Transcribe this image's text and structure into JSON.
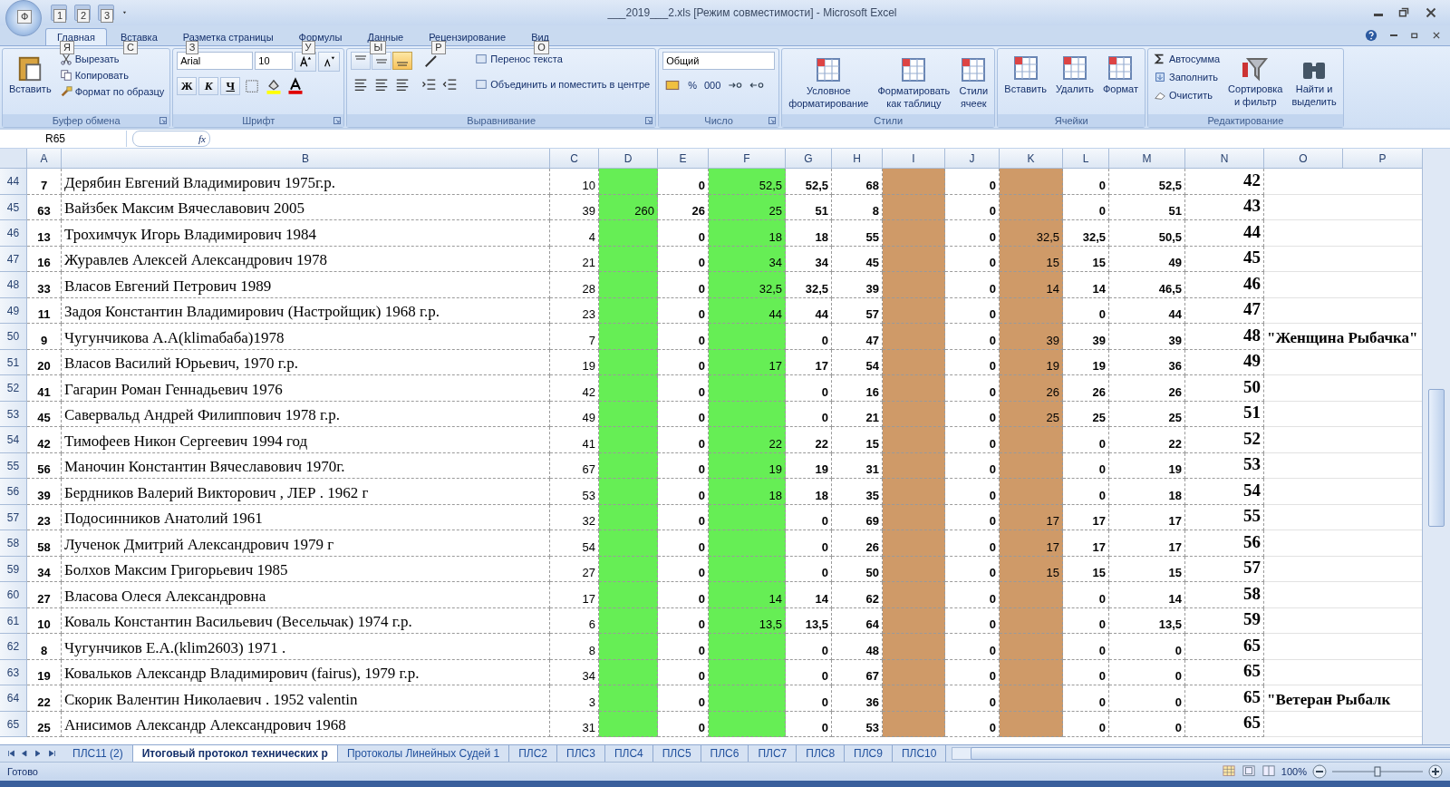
{
  "window": {
    "title": "___2019___2.xls  [Режим совместимости] - Microsoft Excel",
    "office_keytip": "Ф",
    "quick_access_keytips": [
      "1",
      "2",
      "3"
    ]
  },
  "ribbon_tabs": [
    {
      "label": "Главная",
      "keytip": "Я",
      "selected": true
    },
    {
      "label": "Вставка",
      "keytip": "С",
      "selected": false
    },
    {
      "label": "Разметка страницы",
      "keytip": "З",
      "selected": false
    },
    {
      "label": "Формулы",
      "keytip": "У",
      "selected": false
    },
    {
      "label": "Данные",
      "keytip": "Ы",
      "selected": false
    },
    {
      "label": "Рецензирование",
      "keytip": "Р",
      "selected": false
    },
    {
      "label": "Вид",
      "keytip": "О",
      "selected": false
    }
  ],
  "ribbon": {
    "clipboard": {
      "label": "Буфер обмена",
      "paste": "Вставить",
      "items": [
        "Вырезать",
        "Копировать",
        "Формат по образцу"
      ]
    },
    "font": {
      "label": "Шрифт",
      "font_name": "Arial",
      "font_size": "10",
      "styles": [
        "Ж",
        "К",
        "Ч"
      ]
    },
    "alignment": {
      "label": "Выравнивание",
      "vertical": [
        {
          "selected": false
        },
        {
          "selected": false
        },
        {
          "selected": true
        }
      ],
      "wrap": "Перенос текста",
      "merge": "Объединить и поместить в центре"
    },
    "number": {
      "label": "Число",
      "format": "Общий",
      "buttons": [
        "%",
        "000"
      ]
    },
    "styles": {
      "label": "Стили",
      "buttons": [
        "Условное\nформатирование",
        "Форматировать\nкак таблицу",
        "Стили\nячеек"
      ]
    },
    "cells": {
      "label": "Ячейки",
      "buttons": [
        "Вставить",
        "Удалить",
        "Формат"
      ]
    },
    "editing": {
      "label": "Редактирование",
      "items": [
        "Автосумма",
        "Заполнить",
        "Очистить"
      ],
      "buttons": [
        "Сортировка\nи фильтр",
        "Найти и\nвыделить"
      ]
    }
  },
  "formula_bar": {
    "name_box": "R65",
    "fx": "fx"
  },
  "columns": [
    {
      "label": "A"
    },
    {
      "label": "B"
    },
    {
      "label": "C"
    },
    {
      "label": "D",
      "color": "#66ee55"
    },
    {
      "label": "E"
    },
    {
      "label": "F",
      "color": "#66ee55"
    },
    {
      "label": "G"
    },
    {
      "label": "H"
    },
    {
      "label": "I",
      "color": "#cf9a68"
    },
    {
      "label": "J"
    },
    {
      "label": "K",
      "color": "#cf9a68"
    },
    {
      "label": "L"
    },
    {
      "label": "M"
    },
    {
      "label": "N"
    },
    {
      "label": "O"
    },
    {
      "label": "P"
    }
  ],
  "rows": [
    {
      "row": "44",
      "cells": [
        "7",
        "Дерябин Евгений Владимирович 1975г.р.",
        "10",
        null,
        "0",
        "52,5",
        "52,5",
        "68",
        null,
        "0",
        null,
        "0",
        "52,5",
        "42",
        null
      ]
    },
    {
      "row": "45",
      "cells": [
        "63",
        "Вайзбек Максим Вячеславович 2005",
        "39",
        "260",
        "26",
        "25",
        "51",
        "8",
        null,
        "0",
        null,
        "0",
        "51",
        "43",
        null
      ]
    },
    {
      "row": "46",
      "cells": [
        "13",
        "Трохимчук Игорь Владимирович 1984",
        "4",
        null,
        "0",
        "18",
        "18",
        "55",
        null,
        "0",
        "32,5",
        "32,5",
        "50,5",
        "44",
        null
      ]
    },
    {
      "row": "47",
      "cells": [
        "16",
        "Журавлев Алексей Александрович 1978",
        "21",
        null,
        "0",
        "34",
        "34",
        "45",
        null,
        "0",
        "15",
        "15",
        "49",
        "45",
        null
      ]
    },
    {
      "row": "48",
      "cells": [
        "33",
        "Власов Евгений Петрович 1989",
        "28",
        null,
        "0",
        "32,5",
        "32,5",
        "39",
        null,
        "0",
        "14",
        "14",
        "46,5",
        "46",
        null
      ]
    },
    {
      "row": "49",
      "cells": [
        "11",
        "Задоя Константин Владимирович (Настройщик) 1968 г.р.",
        "23",
        null,
        "0",
        "44",
        "44",
        "57",
        null,
        "0",
        null,
        "0",
        "44",
        "47",
        null
      ]
    },
    {
      "row": "50",
      "cells": [
        "9",
        "Чугунчикова А.А(klimaбаба)1978",
        "7",
        null,
        "0",
        null,
        "0",
        "47",
        null,
        "0",
        "39",
        "39",
        "39",
        "48",
        "\"Женщина Рыбачка\""
      ]
    },
    {
      "row": "51",
      "cells": [
        "20",
        "Власов Василий Юрьевич, 1970 г.р.",
        "19",
        null,
        "0",
        "17",
        "17",
        "54",
        null,
        "0",
        "19",
        "19",
        "36",
        "49",
        null
      ]
    },
    {
      "row": "52",
      "cells": [
        "41",
        "Гагарин Роман Геннадьевич 1976",
        "42",
        null,
        "0",
        null,
        "0",
        "16",
        null,
        "0",
        "26",
        "26",
        "26",
        "50",
        null
      ]
    },
    {
      "row": "53",
      "cells": [
        "45",
        "Савервальд Андрей Филиппович 1978 г.р.",
        "49",
        null,
        "0",
        null,
        "0",
        "21",
        null,
        "0",
        "25",
        "25",
        "25",
        "51",
        null
      ]
    },
    {
      "row": "54",
      "cells": [
        "42",
        "Тимофеев Никон Сергеевич 1994 год",
        "41",
        null,
        "0",
        "22",
        "22",
        "15",
        null,
        "0",
        null,
        "0",
        "22",
        "52",
        null
      ]
    },
    {
      "row": "55",
      "cells": [
        "56",
        "Маночин Константин Вячеславович 1970г.",
        "67",
        null,
        "0",
        "19",
        "19",
        "31",
        null,
        "0",
        null,
        "0",
        "19",
        "53",
        null
      ]
    },
    {
      "row": "56",
      "cells": [
        "39",
        "Бердников Валерий Викторович , ЛЕР . 1962 г",
        "53",
        null,
        "0",
        "18",
        "18",
        "35",
        null,
        "0",
        null,
        "0",
        "18",
        "54",
        null
      ]
    },
    {
      "row": "57",
      "cells": [
        "23",
        "Подосинников Анатолий 1961",
        "32",
        null,
        "0",
        null,
        "0",
        "69",
        null,
        "0",
        "17",
        "17",
        "17",
        "55",
        null
      ]
    },
    {
      "row": "58",
      "cells": [
        "58",
        "Лученок Дмитрий Александрович 1979 г",
        "54",
        null,
        "0",
        null,
        "0",
        "26",
        null,
        "0",
        "17",
        "17",
        "17",
        "56",
        null
      ]
    },
    {
      "row": "59",
      "cells": [
        "34",
        "Болхов Максим Григорьевич 1985",
        "27",
        null,
        "0",
        null,
        "0",
        "50",
        null,
        "0",
        "15",
        "15",
        "15",
        "57",
        null
      ]
    },
    {
      "row": "60",
      "cells": [
        "27",
        "Власова Олеся Александровна",
        "17",
        null,
        "0",
        "14",
        "14",
        "62",
        null,
        "0",
        null,
        "0",
        "14",
        "58",
        null
      ]
    },
    {
      "row": "61",
      "cells": [
        "10",
        "Коваль Константин Васильевич (Весельчак) 1974 г.р.",
        "6",
        null,
        "0",
        "13,5",
        "13,5",
        "64",
        null,
        "0",
        null,
        "0",
        "13,5",
        "59",
        null
      ]
    },
    {
      "row": "62",
      "cells": [
        "8",
        "Чугунчиков Е.А.(klim2603) 1971 .",
        "8",
        null,
        "0",
        null,
        "0",
        "48",
        null,
        "0",
        null,
        "0",
        "0",
        "65",
        null
      ]
    },
    {
      "row": "63",
      "cells": [
        "19",
        "Ковальков Александр Владимирович (fairus), 1979 г.р.",
        "34",
        null,
        "0",
        null,
        "0",
        "67",
        null,
        "0",
        null,
        "0",
        "0",
        "65",
        null
      ]
    },
    {
      "row": "64",
      "cells": [
        "22",
        "Скорик Валентин Николаевич . 1952 valentin",
        "3",
        null,
        "0",
        null,
        "0",
        "36",
        null,
        "0",
        null,
        "0",
        "0",
        "65",
        "\"Ветеран Рыбалк"
      ]
    },
    {
      "row": "65",
      "cells": [
        "25",
        "Анисимов Александр Александрович 1968",
        "31",
        null,
        "0",
        null,
        "0",
        "53",
        null,
        "0",
        null,
        "0",
        "0",
        "65",
        null
      ]
    }
  ],
  "sheet_tabs": [
    {
      "label": "ПЛС11 (2)",
      "selected": false
    },
    {
      "label": "Итоговый протокол технических р",
      "selected": true
    },
    {
      "label": "Протоколы Линейных Судей 1",
      "selected": false
    },
    {
      "label": "ПЛС2",
      "selected": false
    },
    {
      "label": "ПЛС3",
      "selected": false
    },
    {
      "label": "ПЛС4",
      "selected": false
    },
    {
      "label": "ПЛС5",
      "selected": false
    },
    {
      "label": "ПЛС6",
      "selected": false
    },
    {
      "label": "ПЛС7",
      "selected": false
    },
    {
      "label": "ПЛС8",
      "selected": false
    },
    {
      "label": "ПЛС9",
      "selected": false
    },
    {
      "label": "ПЛС10",
      "selected": false
    }
  ],
  "status_bar": {
    "status": "Готово",
    "zoom": "100%",
    "zoom_slider": {
      "level": 0.5
    }
  }
}
